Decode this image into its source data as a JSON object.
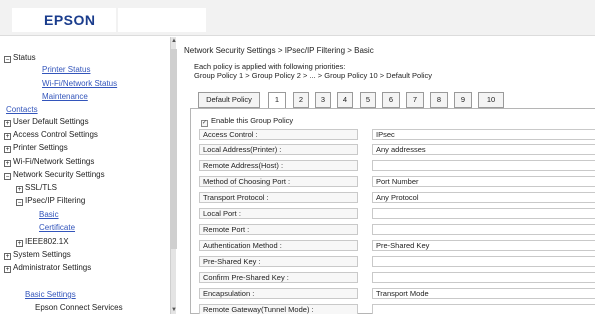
{
  "header": {
    "logo": "EPSON"
  },
  "sidebar": {
    "status": "Status",
    "printer_status": "Printer Status",
    "wifi_network_status": "Wi-Fi/Network Status",
    "maintenance": "Maintenance",
    "contacts": "Contacts",
    "user_default": "User Default Settings",
    "access_control": "Access Control Settings",
    "printer_settings": "Printer Settings",
    "wifi_network_settings": "Wi-Fi/Network Settings",
    "network_security": "Network Security Settings",
    "ssl_tls": "SSL/TLS",
    "ipsec": "IPsec/IP Filtering",
    "basic": "Basic",
    "certificate": "Certificate",
    "ieee": "IEEE802.1X",
    "system": "System Settings",
    "administrator": "Administrator Settings",
    "basic_settings": "Basic Settings",
    "epson_connect": "Epson Connect Services"
  },
  "main": {
    "breadcrumb": "Network Security Settings > IPsec/IP Filtering > Basic",
    "priority_line1": "Each policy is applied with following priorities:",
    "priority_line2": "Group Policy 1 > Group Policy 2 > ... > Group Policy 10 > Default Policy",
    "tabs": [
      "Default Policy",
      "1",
      "2",
      "3",
      "4",
      "5",
      "6",
      "7",
      "8",
      "9",
      "10"
    ],
    "active_tab": "1",
    "enable_label": "Enable this Group Policy",
    "enable_checked": true,
    "rows": [
      {
        "label": "Access Control :",
        "value": "IPsec"
      },
      {
        "label": "Local Address(Printer) :",
        "value": "Any addresses"
      },
      {
        "label": "Remote Address(Host) :",
        "value": ""
      },
      {
        "label": "Method of Choosing Port :",
        "value": "Port Number"
      },
      {
        "label": "Transport Protocol :",
        "value": "Any Protocol"
      },
      {
        "label": "Local Port :",
        "value": ""
      },
      {
        "label": "Remote Port :",
        "value": ""
      },
      {
        "label": "Authentication Method :",
        "value": "Pre-Shared Key"
      },
      {
        "label": "Pre-Shared Key :",
        "value": ""
      },
      {
        "label": "Confirm Pre-Shared Key :",
        "value": ""
      },
      {
        "label": "Encapsulation :",
        "value": "Transport Mode"
      },
      {
        "label": "Remote Gateway(Tunnel Mode) :",
        "value": ""
      }
    ]
  },
  "colors": {
    "link": "#3355bb",
    "logo": "#1a3c8c"
  }
}
